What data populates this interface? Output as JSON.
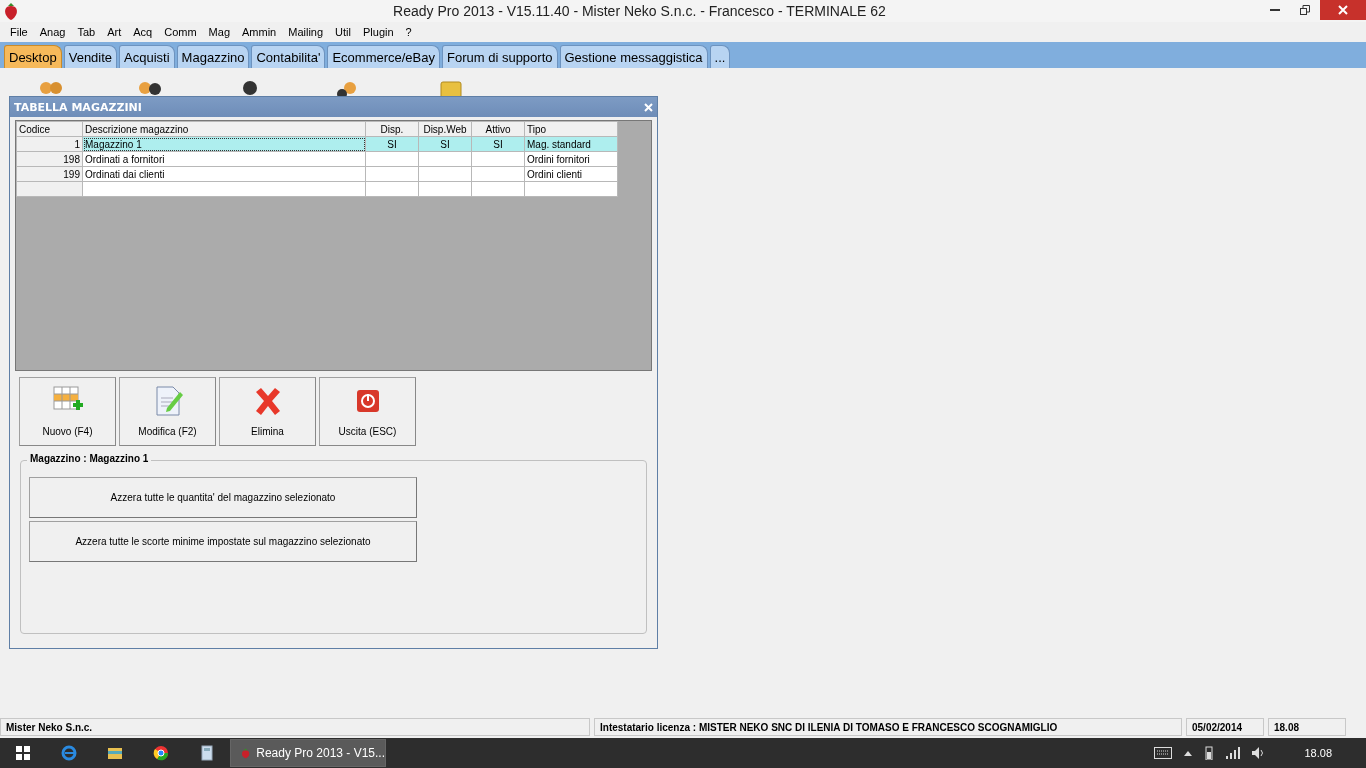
{
  "window": {
    "title": "Ready Pro 2013 - V15.11.40 - Mister Neko S.n.c. - Francesco - TERMINALE 62"
  },
  "menu": [
    "File",
    "Anag",
    "Tab",
    "Art",
    "Acq",
    "Comm",
    "Mag",
    "Ammin",
    "Mailing",
    "Util",
    "Plugin",
    "?"
  ],
  "tabs": [
    {
      "label": "Desktop",
      "selected": true
    },
    {
      "label": "Vendite",
      "selected": false
    },
    {
      "label": "Acquisti",
      "selected": false
    },
    {
      "label": "Magazzino",
      "selected": false
    },
    {
      "label": "Contabilita'",
      "selected": false
    },
    {
      "label": "Ecommerce/eBay",
      "selected": false
    },
    {
      "label": "Forum di supporto",
      "selected": false
    },
    {
      "label": "Gestione messaggistica",
      "selected": false
    },
    {
      "label": "...",
      "selected": false
    }
  ],
  "dialog": {
    "title": "TABELLA MAGAZZINI",
    "table": {
      "columns": [
        "Codice",
        "Descrizione magazzino",
        "Disp.",
        "Disp.Web",
        "Attivo",
        "Tipo"
      ],
      "rows": [
        {
          "cells": [
            "1",
            "Magazzino 1",
            "SI",
            "SI",
            "SI",
            "Mag. standard"
          ],
          "selected": true
        },
        {
          "cells": [
            "198",
            "Ordinati a fornitori",
            "",
            "",
            "",
            "Ordini fornitori"
          ],
          "selected": false
        },
        {
          "cells": [
            "199",
            "Ordinati dai clienti",
            "",
            "",
            "",
            "Ordini clienti"
          ],
          "selected": false
        }
      ]
    },
    "buttons": [
      {
        "label": "Nuovo (F4)",
        "kind": "new"
      },
      {
        "label": "Modifica (F2)",
        "kind": "edit"
      },
      {
        "label": "Elimina",
        "kind": "delete"
      },
      {
        "label": "Uscita (ESC)",
        "kind": "exit"
      }
    ],
    "group": {
      "title": "Magazzino : Magazzino 1",
      "buttons": [
        "Azzera tutte le quantita' del magazzino selezionato",
        "Azzera tutte le scorte minime impostate sul magazzino selezionato"
      ]
    }
  },
  "status_bar": [
    "Mister Neko S.n.c.",
    "Intestatario licenza : MISTER NEKO SNC DI ILENIA DI TOMASO E FRANCESCO SCOGNAMIGLIO",
    "05/02/2014",
    "18.08"
  ],
  "taskbar": {
    "apps": [
      {
        "label": "Ready Pro 2013 - V15...",
        "active": true
      }
    ],
    "clock": "18.08"
  }
}
